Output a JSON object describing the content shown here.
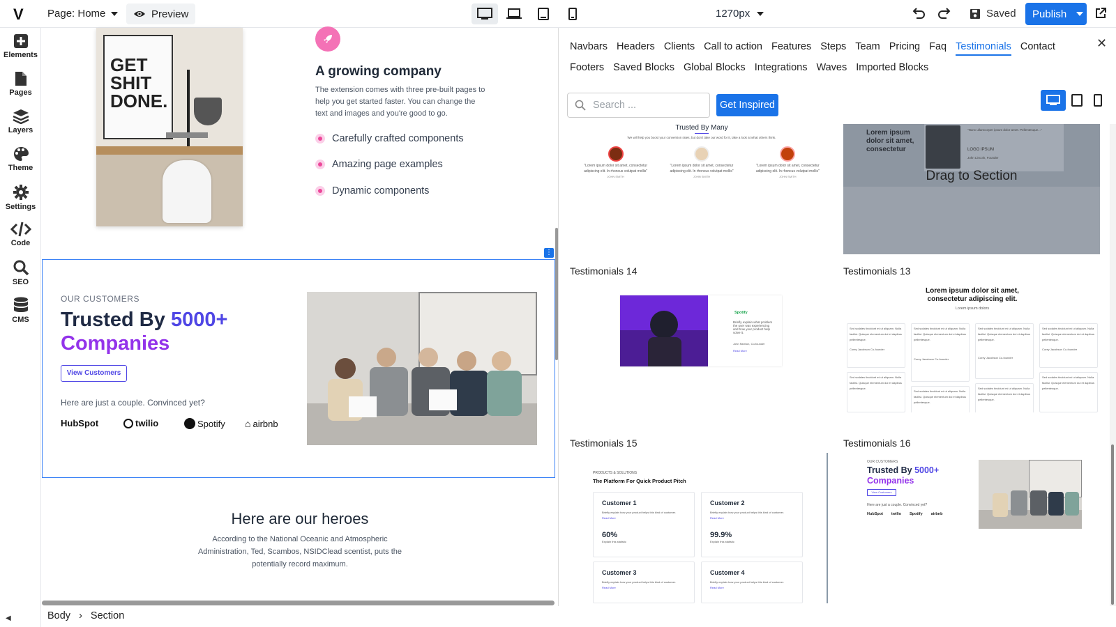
{
  "app": {
    "logo": "V"
  },
  "toolbar": {
    "page_label": "Page: Home",
    "preview_label": "Preview",
    "width_value": "1270px",
    "saved_label": "Saved",
    "publish_label": "Publish"
  },
  "sidebar": {
    "items": [
      {
        "label": "Elements",
        "icon": "plus-square-icon"
      },
      {
        "label": "Pages",
        "icon": "file-icon"
      },
      {
        "label": "Layers",
        "icon": "layers-icon"
      },
      {
        "label": "Theme",
        "icon": "palette-icon"
      },
      {
        "label": "Settings",
        "icon": "gear-icon"
      },
      {
        "label": "Code",
        "icon": "code-icon"
      },
      {
        "label": "SEO",
        "icon": "search-icon"
      },
      {
        "label": "CMS",
        "icon": "database-icon"
      }
    ]
  },
  "canvas": {
    "poster_text": [
      "GET",
      "SHIT",
      "DONE."
    ],
    "growing": {
      "title": "A growing company",
      "desc": "The extension comes with three pre-built pages to help you get started faster. You can change the text and images and you're good to go.",
      "features": [
        "Carefully crafted components",
        "Amazing page examples",
        "Dynamic components"
      ]
    },
    "customers": {
      "eyebrow": "OUR CUSTOMERS",
      "title_part1": "Trusted By ",
      "title_part2": "5000+",
      "title_part3": "Companies",
      "button": "View Customers",
      "subtitle": "Here are just a couple. Convinced yet?",
      "brands": [
        "HubSpot",
        "twilio",
        "Spotify",
        "airbnb"
      ]
    },
    "heroes": {
      "title": "Here are our heroes",
      "desc": "According to the National Oceanic and Atmospheric Administration, Ted, Scambos, NSIDClead scentist, puts the potentially record maximum."
    }
  },
  "breadcrumb": {
    "items": [
      "Body",
      "Section"
    ]
  },
  "panel": {
    "tabs": [
      "Navbars",
      "Headers",
      "Clients",
      "Call to action",
      "Features",
      "Steps",
      "Team",
      "Pricing",
      "Faq",
      "Testimonials",
      "Contact",
      "Footers",
      "Saved Blocks",
      "Global Blocks",
      "Integrations",
      "Waves",
      "Imported Blocks"
    ],
    "active_tab": "Testimonials",
    "search_placeholder": "Search ...",
    "inspired_label": "Get Inspired",
    "drag_label": "Drag to Section",
    "thumbs": {
      "top_left": {
        "title": "Trusted By Many",
        "sub": "We will help you boost your conversion rates, but don't take our word for it, take a look at what others think.",
        "quote": "\"Lorem ipsum dolor sit amet, consectetur adipiscing elit. In rhoncus volutpat mollis\"",
        "name": "JOHN SMITH"
      },
      "top_right": {
        "heading": "Lorem ipsum dolor sit amet, consectetur",
        "quote": "\"Nunc ullamcorper ipsum dolor amet. Pellentesque...\"",
        "logo": "LOGO IPSUM",
        "person": "John Lincoln, Founder"
      },
      "t14": {
        "label": "Testimonials 14",
        "brand": "Spotify",
        "text": "Briefly explain what problem the user was experiencing and how your product help solve it.",
        "person": "John Newton, Co-founder",
        "link": "Read More"
      },
      "t13": {
        "label": "Testimonials 13",
        "title": "Lorem ipsum dolor sit amet, consectetur adipiscing elit.",
        "sub": "Lorem ipsum dolors",
        "card_text": "Sed sodales tincidunt mi ut aliquam. Nulla facilisi. Quisque elementum dui et dapibus pellentesque.",
        "person": "Corey Jacobson",
        "role": "Co-founder"
      },
      "t15": {
        "label": "Testimonials 15",
        "eyebrow": "PRODUCTS & SOLUTIONS",
        "title": "The Platform For Quick Product Pitch",
        "cards": [
          {
            "name": "Customer 1",
            "stat": "60%"
          },
          {
            "name": "Customer 2",
            "stat": "99.9%"
          },
          {
            "name": "Customer 3",
            "stat": ""
          },
          {
            "name": "Customer 4",
            "stat": ""
          }
        ],
        "card_text": "Briefly explain how your product helps this kind of customer.",
        "link": "Read More",
        "stat_caption": "Explain this statistic"
      },
      "t16": {
        "label": "Testimonials 16",
        "eyebrow": "OUR CUSTOMERS",
        "title_a": "Trusted By ",
        "title_b": "5000+",
        "title_c": "Companies",
        "button": "View Customers",
        "sub": "Here are just a couple. Convinced yet?",
        "brands": [
          "HubSpot",
          "twilio",
          "Spotify",
          "airbnb"
        ]
      }
    }
  },
  "colors": {
    "accent": "#1a73e8",
    "indigo": "#4f46e5",
    "purple": "#9333ea",
    "pink": "#f472b6"
  }
}
